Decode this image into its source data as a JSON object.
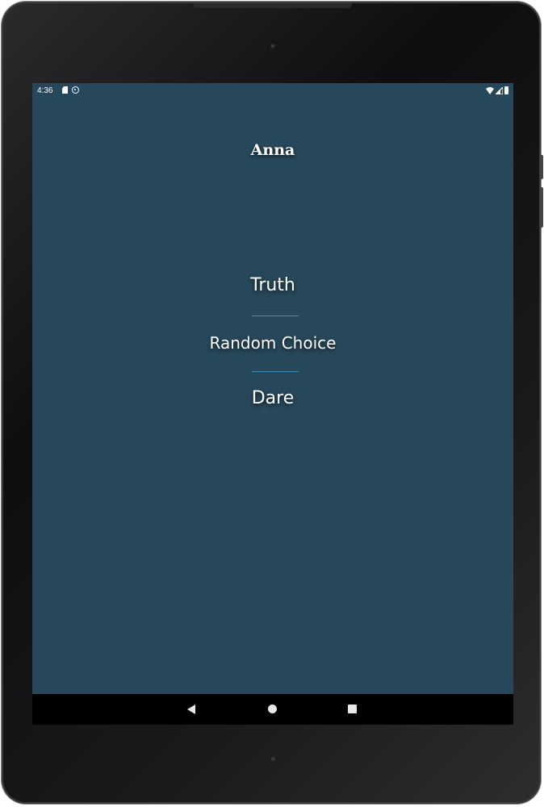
{
  "status_bar": {
    "time": "4:36",
    "icons": [
      "sd-card-icon",
      "sync-icon",
      "wifi-icon",
      "cell-signal-icon",
      "battery-icon"
    ]
  },
  "player": {
    "name": "Anna"
  },
  "choices": {
    "truth_label": "Truth",
    "random_label": "Random Choice",
    "dare_label": "Dare"
  },
  "navigation": {
    "icons": [
      "back-icon",
      "home-icon",
      "recents-icon"
    ]
  },
  "colors": {
    "background": "#27475a",
    "divider": "#3a8db0",
    "text": "#ffffff",
    "nav_bar": "#000000"
  }
}
